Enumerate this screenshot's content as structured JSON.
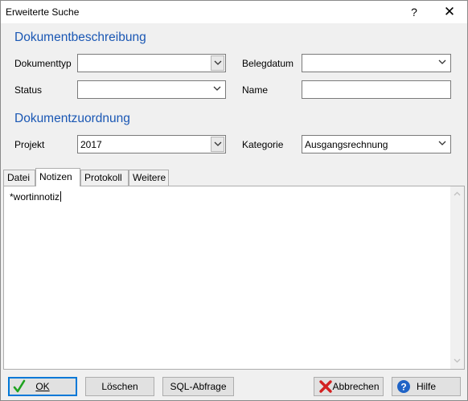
{
  "window": {
    "title": "Erweiterte Suche",
    "help_glyph": "?",
    "close_glyph": "✕"
  },
  "sections": {
    "description_title": "Dokumentbeschreibung",
    "assignment_title": "Dokumentzuordnung"
  },
  "fields": {
    "dokumenttyp": {
      "label": "Dokumenttyp",
      "value": ""
    },
    "belegdatum": {
      "label": "Belegdatum",
      "value": ""
    },
    "status": {
      "label": "Status",
      "value": ""
    },
    "name": {
      "label": "Name",
      "value": ""
    },
    "projekt": {
      "label": "Projekt",
      "value": "2017"
    },
    "kategorie": {
      "label": "Kategorie",
      "value": "Ausgangsrechnung"
    }
  },
  "tabs": [
    {
      "label": "Datei",
      "active": false
    },
    {
      "label": "Notizen",
      "active": true
    },
    {
      "label": "Protokoll",
      "active": false
    },
    {
      "label": "Weitere",
      "active": false
    }
  ],
  "notes": {
    "value": "*wortinnotiz"
  },
  "buttons": {
    "ok": "OK",
    "loeschen": "Löschen",
    "sql": "SQL-Abfrage",
    "abbrechen": "Abbrechen",
    "hilfe": "Hilfe"
  },
  "icons": {
    "ok": "green-checkmark-icon",
    "abbrechen": "red-x-icon",
    "hilfe": "blue-question-icon"
  },
  "colors": {
    "section_title": "#1a57b4",
    "focus_border": "#0078d7"
  }
}
